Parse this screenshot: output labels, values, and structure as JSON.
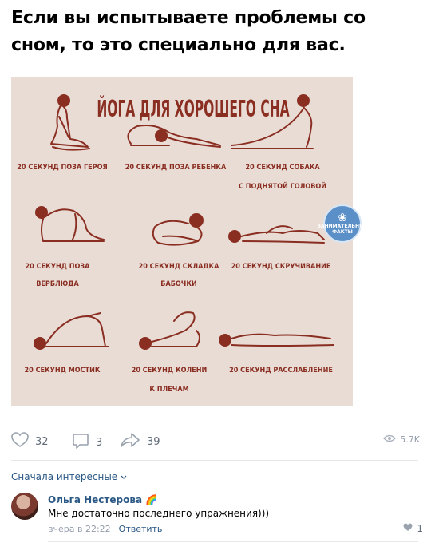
{
  "post": {
    "title": "Если вы испытываете проблемы со\nсном, то это специально для вас."
  },
  "poster": {
    "heading": "ЙОГА ДЛЯ ХОРОШЕГО СНА",
    "poses": [
      {
        "line1": "20 СЕКУНД ПОЗА ГЕРОЯ",
        "line2": ""
      },
      {
        "line1": "20 СЕКУНД ПОЗА РЕБЕНКА",
        "line2": ""
      },
      {
        "line1": "20 СЕКУНД СОБАКА",
        "line2": "С ПОДНЯТОЙ ГОЛОВОЙ"
      },
      {
        "line1": "20 СЕКУНД ПОЗА",
        "line2": "ВЕРБЛЮДА"
      },
      {
        "line1": "20 СЕКУНД СКЛАДКА",
        "line2": "БАБОЧКИ"
      },
      {
        "line1": "20 СЕКУНД СКРУЧИВАНИЕ",
        "line2": ""
      },
      {
        "line1": "20 СЕКУНД МОСТИК",
        "line2": ""
      },
      {
        "line1": "20 СЕКУНД КОЛЕНИ",
        "line2": "К ПЛЕЧАМ"
      },
      {
        "line1": "20 СЕКУНД РАССЛАБЛЕНИЕ",
        "line2": ""
      }
    ],
    "badge_text": "ЗАНИМАТЕЛЬНЫЕ ФАКТЫ",
    "ink_color": "#8a2e22",
    "background_color": "#e9dcd5"
  },
  "actions": {
    "likes": "32",
    "comments": "3",
    "shares": "39",
    "views": "5.7K"
  },
  "comments_section": {
    "sort_label": "Сначала интересные",
    "items": [
      {
        "author": "Ольга Нестерова",
        "author_badge": "🌈",
        "text": "Мне достаточно последнего упражнения)))",
        "time": "вчера в 22:22",
        "reply_label": "Ответить",
        "likes": "1"
      }
    ]
  },
  "colors": {
    "link": "#2a5885",
    "muted": "#939cab",
    "icon": "#626d7a"
  }
}
